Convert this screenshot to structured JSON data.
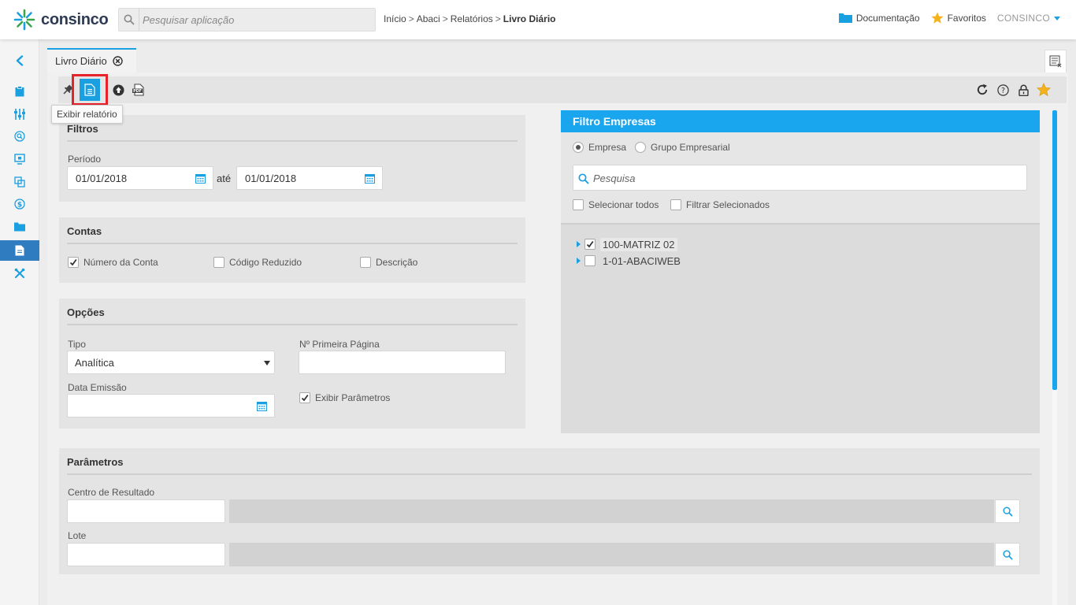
{
  "brand": {
    "name": "consinco"
  },
  "search": {
    "placeholder": "Pesquisar aplicação"
  },
  "breadcrumb": {
    "items": [
      "Início",
      "Abaci",
      "Relatórios"
    ],
    "current": "Livro Diário"
  },
  "topbar": {
    "documentation": "Documentação",
    "favorites": "Favoritos",
    "user": "CONSINCO"
  },
  "sidebar": {
    "items": [
      "collapse-chevron-icon",
      "clipboard-icon",
      "sliders-icon",
      "search-circle-icon",
      "monitor-icon",
      "copy-icon",
      "dollar-icon",
      "folder-icon",
      "document-icon",
      "tools-icon"
    ],
    "active": "document-icon"
  },
  "tab": {
    "label": "Livro Diário"
  },
  "toolbar": {
    "tooltip": "Exibir relatório"
  },
  "filtros": {
    "title": "Filtros",
    "periodo_label": "Período",
    "data_inicio": "01/01/2018",
    "ate_label": "até",
    "data_fim": "01/01/2018"
  },
  "contas": {
    "title": "Contas",
    "numero_conta": {
      "label": "Número da Conta",
      "checked": true
    },
    "codigo_reduzido": {
      "label": "Código Reduzido",
      "checked": false
    },
    "descricao": {
      "label": "Descrição",
      "checked": false
    }
  },
  "opcoes": {
    "title": "Opções",
    "tipo_label": "Tipo",
    "tipo_value": "Analítica",
    "primeira_pagina_label": "Nº Primeira Página",
    "primeira_pagina_value": "",
    "data_emissao_label": "Data Emissão",
    "data_emissao_value": "",
    "exibir_parametros": {
      "label": "Exibir Parâmetros",
      "checked": true
    }
  },
  "empresas": {
    "title": "Filtro Empresas",
    "radio_empresa": "Empresa",
    "radio_grupo": "Grupo Empresarial",
    "selected_radio": "Empresa",
    "search_placeholder": "Pesquisa",
    "selecionar_todos": "Selecionar todos",
    "filtrar_selecionados": "Filtrar Selecionados",
    "tree": [
      {
        "label": "100-MATRIZ 02",
        "checked": true
      },
      {
        "label": "1-01-ABACIWEB",
        "checked": false
      }
    ]
  },
  "parametros": {
    "title": "Parâmetros",
    "centro_label": "Centro de Resultado",
    "centro_value": "",
    "lote_label": "Lote",
    "lote_value": ""
  },
  "colors": {
    "accent": "#1a9fe0",
    "highlight_border": "#e8222b",
    "star": "#f5b21b",
    "sidebar_active": "#2f7dc0"
  }
}
